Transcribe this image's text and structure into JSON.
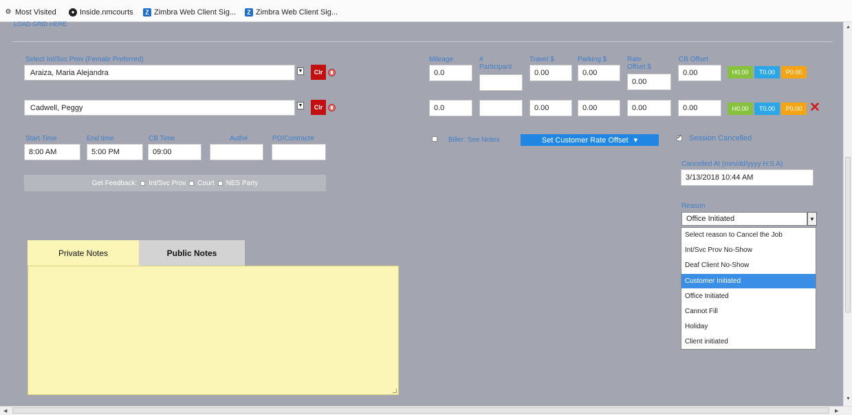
{
  "bookmarks": [
    {
      "label": "Most Visited",
      "icon": "gear-icon"
    },
    {
      "label": "Inside.nmcourts",
      "icon": "globe-icon"
    },
    {
      "label": "Zimbra Web Client Sig...",
      "icon": "zimbra-icon"
    },
    {
      "label": "Zimbra Web Client Sig...",
      "icon": "zimbra-icon"
    }
  ],
  "top_link": "LOAD GRID HERE",
  "provider": {
    "label": "Select Int/Svc Prov (Female Preferred)",
    "rows": [
      {
        "name": "Araiza, Maria Alejandra",
        "clear": "Clr"
      },
      {
        "name": "Cadwell, Peggy",
        "clear": "Clr"
      }
    ]
  },
  "rates": {
    "headers": {
      "mileage": "Mileage",
      "participant": "# Participant",
      "travel": "Travel $",
      "parking": "Parking $",
      "rate_offset": "Rate Offset $",
      "cb_offset": "CB Offset"
    },
    "rows": [
      {
        "mileage": "0.0",
        "participant": "",
        "travel": "0.00",
        "parking": "0.00",
        "rate_offset": "0.00",
        "cb_offset": "0.00",
        "h": "H0.00",
        "t": "T0.00",
        "p": "P0.00"
      },
      {
        "mileage": "0.0",
        "participant": "",
        "travel": "0.00",
        "parking": "0.00",
        "rate_offset": "0.00",
        "cb_offset": "0.00",
        "h": "H0.00",
        "t": "T0.00",
        "p": "P0.00"
      }
    ],
    "remove_icon": "close-icon"
  },
  "times": {
    "start_label": "Start Time",
    "start": "8:00 AM",
    "end_label": "End time",
    "end": "5:00 PM",
    "cb_label": "CB Time",
    "cb": "09:00",
    "auth_label": "Auth#",
    "auth": "",
    "po_label": "PO/Contract#",
    "po": ""
  },
  "feedback": {
    "label": "Get Feedback:",
    "options": [
      "Int/Svc Prov",
      "Court",
      "NES Party"
    ]
  },
  "biller": {
    "label": "Biller: See Notes",
    "checked": false
  },
  "set_rate_button": "Set Customer Rate Offset",
  "session": {
    "cancelled_label": "Session Cancelled",
    "cancelled_checked": true,
    "cancelled_at_label": "Cancelled At (mm/dd/yyyy H:S A)",
    "cancelled_at": "3/13/2018 10:44 AM",
    "reason_label": "Reason",
    "reason_value": "Office Initiated",
    "reason_options": [
      "Select reason to Cancel the Job",
      "Int/Svc Prov No-Show",
      "Deaf Client No-Show",
      "Customer Initiated",
      "Office Initiated",
      "Cannot Fill",
      "Holiday",
      "Client initiated"
    ],
    "highlighted_option": "Customer Initiated"
  },
  "notes": {
    "tabs": [
      {
        "label": "Private Notes",
        "active": true
      },
      {
        "label": "Public Notes",
        "active": false
      }
    ],
    "text": ""
  },
  "colors": {
    "panel": "#a3a5b0",
    "label_blue": "#3f7fc9",
    "clear_red": "#c30f0f",
    "h_green": "#86c23b",
    "t_blue": "#2ba7e8",
    "p_orange": "#f5a414",
    "notes_yellow": "#fbf5b6",
    "highlight_blue": "#3a8ee6"
  }
}
